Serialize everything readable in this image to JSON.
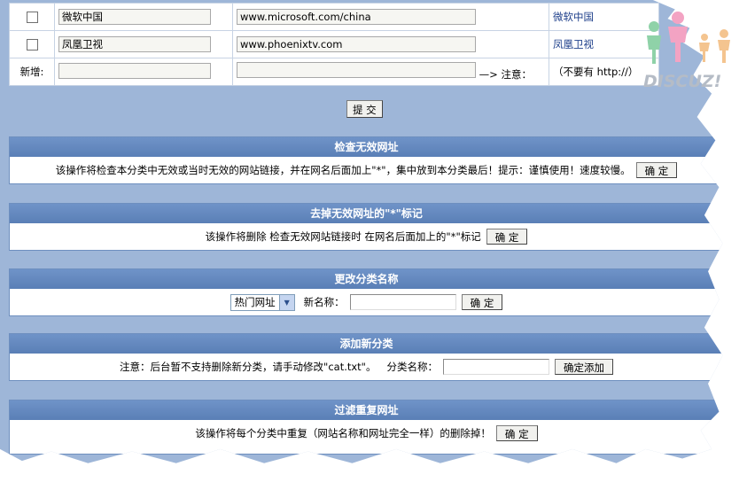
{
  "links": [
    {
      "name": "微软中国",
      "url": "www.microsoft.com/china",
      "display": "微软中国"
    },
    {
      "name": "凤凰卫视",
      "url": "www.phoenixtv.com",
      "display": "凤凰卫视"
    }
  ],
  "new_row": {
    "label": "新增:",
    "arrow_note": "—> 注意：",
    "hint": "（不要有 http://）"
  },
  "submit_label": "提 交",
  "sections": {
    "check_invalid": {
      "title": "检查无效网址",
      "desc": "该操作将检查本分类中无效或当时无效的网站链接，并在网名后面加上\"*\"，集中放到本分类最后！提示：谨慎使用！速度较慢。",
      "button": "确 定"
    },
    "remove_mark": {
      "title": "去掉无效网址的\"*\"标记",
      "desc": "该操作将删除 检查无效网站链接时 在网名后面加上的\"*\"标记",
      "button": "确 定"
    },
    "rename": {
      "title": "更改分类名称",
      "select_value": "热门网址",
      "new_name_label": "新名称：",
      "button": "确 定"
    },
    "add_category": {
      "title": "添加新分类",
      "note": "注意：后台暂不支持删除新分类，请手动修改\"cat.txt\"。",
      "name_label": "分类名称：",
      "button": "确定添加"
    },
    "filter_dup": {
      "title": "过滤重复网址",
      "desc": "该操作将每个分类中重复（网站名称和网址完全一样）的删除掉！",
      "button": "确 定"
    }
  },
  "watermark": "DISCUZ!",
  "colors": {
    "header": "#5a7fb6",
    "panel": "#9eb6d8",
    "link": "#1d3e8a"
  }
}
